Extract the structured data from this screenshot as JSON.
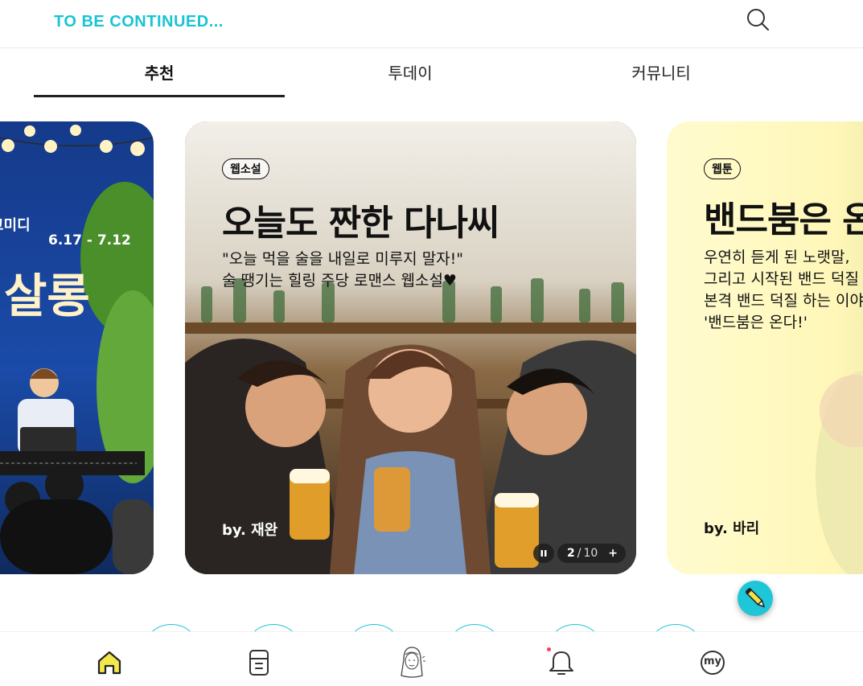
{
  "header": {
    "logo_text": "TO BE CONTINUED...",
    "search_icon": "search-icon"
  },
  "tabs": [
    {
      "label": "추천",
      "active": true
    },
    {
      "label": "투데이",
      "active": false
    },
    {
      "label": "커뮤니티",
      "active": false
    }
  ],
  "carousel": {
    "left_card": {
      "partial_label": "코미디",
      "dates": "6.17 - 7.12",
      "title_partial": "살롱"
    },
    "center_card": {
      "tag": "웹소설",
      "title": "오늘도 짠한 다나씨",
      "description_lines": [
        "\"오늘 먹을 술을 내일로 미루지 말자!\"",
        "술 땡기는 힐링 주당 로맨스 웹소설♥"
      ],
      "author": "by. 재완"
    },
    "right_card": {
      "tag": "웹툰",
      "title_partial": "밴드붐은 온",
      "description_lines": [
        "우연히 듣게 된 노랫말,",
        "그리고 시작된 밴드 덕질",
        "본격 밴드 덕질 하는 이야기",
        "'밴드붐은 온다!'"
      ],
      "author": "by. 바리"
    },
    "pager": {
      "current": "2",
      "separator": "/",
      "total": "10",
      "plus": "+"
    }
  },
  "fab": {
    "icon": "pencil-icon"
  },
  "bottom_nav": [
    {
      "name": "home",
      "icon": "home-icon",
      "active": true
    },
    {
      "name": "library",
      "icon": "library-icon",
      "active": false
    },
    {
      "name": "character",
      "icon": "character-avatar-icon",
      "active": false
    },
    {
      "name": "notifications",
      "icon": "bell-icon",
      "active": false,
      "badge": true
    },
    {
      "name": "my",
      "icon": "my-icon",
      "label": "my",
      "active": false
    }
  ],
  "colors": {
    "accent": "#1fc6d8",
    "logo": "#19c4d4",
    "home_active_fill": "#f3e84a",
    "right_card_bg": "#fff7b8",
    "left_card_bg": "#1a4ba8",
    "badge": "#ff3b5c"
  }
}
